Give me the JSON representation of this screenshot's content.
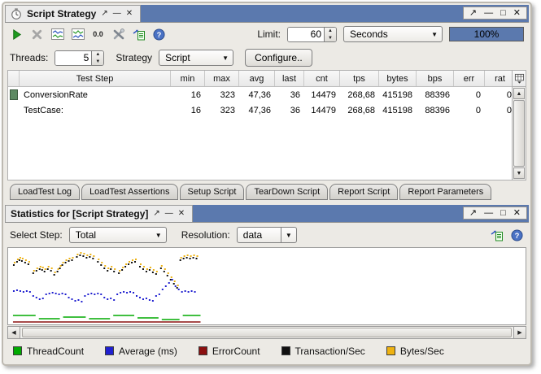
{
  "icons": {
    "float": "↗",
    "minimize": "—",
    "maximize": "□",
    "close": "✕",
    "spin_up": "▲",
    "spin_down": "▼",
    "dropdown": "▼",
    "scroll_up": "▲",
    "scroll_down": "▼",
    "scroll_left": "◀",
    "scroll_right": "▶",
    "help": "?"
  },
  "colors": {
    "titlebar_blue": "#5b79ae",
    "panel_bg": "#eceae5",
    "progress_fill": "#5b79ae",
    "row_icon_green": "#5d8a62"
  },
  "top_panel": {
    "title": "Script Strategy",
    "toolbar": {
      "reset_label": "0.0",
      "limit_label": "Limit:",
      "limit_value": "60",
      "limit_unit": "Seconds",
      "progress": "100%"
    },
    "settings": {
      "threads_label": "Threads:",
      "threads_value": "5",
      "strategy_label": "Strategy",
      "strategy_value": "Script",
      "configure_label": "Configure.."
    },
    "table": {
      "columns": [
        "Test Step",
        "min",
        "max",
        "avg",
        "last",
        "cnt",
        "tps",
        "bytes",
        "bps",
        "err",
        "rat"
      ],
      "rows": [
        {
          "name": "ConversionRate",
          "has_icon": true,
          "values": [
            "16",
            "323",
            "47,36",
            "36",
            "14479",
            "268,68",
            "415198",
            "88396",
            "0",
            "0"
          ]
        },
        {
          "name": "TestCase:",
          "has_icon": false,
          "values": [
            "16",
            "323",
            "47,36",
            "36",
            "14479",
            "268,68",
            "415198",
            "88396",
            "0",
            "0"
          ]
        }
      ]
    },
    "tabs": [
      "LoadTest Log",
      "LoadTest Assertions",
      "Setup Script",
      "TearDown Script",
      "Report Script",
      "Report Parameters"
    ]
  },
  "bottom_panel": {
    "title": "Statistics for [Script Strategy]",
    "select_step_label": "Select Step:",
    "select_step_value": "Total",
    "resolution_label": "Resolution:",
    "resolution_value": "data",
    "legend": [
      {
        "label": "ThreadCount",
        "color": "#00aa00"
      },
      {
        "label": "Average (ms)",
        "color": "#2020d0"
      },
      {
        "label": "ErrorCount",
        "color": "#8b1010"
      },
      {
        "label": "Transaction/Sec",
        "color": "#101010"
      },
      {
        "label": "Bytes/Sec",
        "color": "#eeb211"
      }
    ]
  },
  "chart_data": {
    "type": "scatter",
    "title": "",
    "xlabel": "",
    "ylabel": "",
    "axes_visible": false,
    "legend_position": "bottom",
    "x_range": [
      0,
      640
    ],
    "y_range": [
      0,
      94
    ],
    "y_inverted": true,
    "series": [
      {
        "name": "ErrorCount",
        "color": "#8b1010",
        "style": "line",
        "points": [
          [
            6,
            91
          ],
          [
            238,
            91
          ]
        ]
      },
      {
        "name": "ThreadCount",
        "color": "#00aa00",
        "style": "segments",
        "segments": [
          [
            [
              6,
              83
            ],
            [
              34,
              83
            ]
          ],
          [
            [
              38,
              87
            ],
            [
              64,
              87
            ]
          ],
          [
            [
              68,
              85
            ],
            [
              96,
              85
            ]
          ],
          [
            [
              100,
              87
            ],
            [
              126,
              87
            ]
          ],
          [
            [
              130,
              83
            ],
            [
              156,
              83
            ]
          ],
          [
            [
              160,
              86
            ],
            [
              186,
              86
            ]
          ],
          [
            [
              190,
              88
            ],
            [
              212,
              88
            ]
          ],
          [
            [
              216,
              83
            ],
            [
              238,
              83
            ]
          ]
        ]
      },
      {
        "name": "Average (ms)",
        "color": "#2020d0",
        "style": "dots",
        "points": [
          [
            6,
            52
          ],
          [
            10,
            51
          ],
          [
            14,
            52
          ],
          [
            18,
            53
          ],
          [
            22,
            52
          ],
          [
            26,
            53
          ],
          [
            30,
            58
          ],
          [
            34,
            60
          ],
          [
            38,
            62
          ],
          [
            42,
            61
          ],
          [
            46,
            56
          ],
          [
            50,
            55
          ],
          [
            54,
            54
          ],
          [
            58,
            55
          ],
          [
            62,
            56
          ],
          [
            66,
            55
          ],
          [
            70,
            56
          ],
          [
            74,
            60
          ],
          [
            78,
            62
          ],
          [
            82,
            64
          ],
          [
            86,
            63
          ],
          [
            90,
            65
          ],
          [
            94,
            58
          ],
          [
            98,
            56
          ],
          [
            102,
            55
          ],
          [
            106,
            56
          ],
          [
            110,
            55
          ],
          [
            114,
            56
          ],
          [
            118,
            60
          ],
          [
            122,
            62
          ],
          [
            126,
            61
          ],
          [
            130,
            63
          ],
          [
            134,
            56
          ],
          [
            138,
            54
          ],
          [
            142,
            53
          ],
          [
            146,
            54
          ],
          [
            150,
            53
          ],
          [
            154,
            54
          ],
          [
            158,
            58
          ],
          [
            162,
            60
          ],
          [
            166,
            62
          ],
          [
            170,
            61
          ],
          [
            174,
            63
          ],
          [
            178,
            64
          ],
          [
            182,
            58
          ],
          [
            186,
            56
          ],
          [
            190,
            50
          ],
          [
            194,
            46
          ],
          [
            198,
            42
          ],
          [
            202,
            38
          ],
          [
            206,
            46
          ],
          [
            210,
            50
          ],
          [
            214,
            53
          ],
          [
            218,
            52
          ],
          [
            222,
            53
          ],
          [
            226,
            52
          ],
          [
            230,
            53
          ]
        ]
      },
      {
        "name": "Transaction/Sec",
        "color": "#101010",
        "style": "dots",
        "points": [
          [
            6,
            20
          ],
          [
            10,
            16
          ],
          [
            13,
            14
          ],
          [
            16,
            15
          ],
          [
            20,
            17
          ],
          [
            24,
            19
          ],
          [
            30,
            30
          ],
          [
            34,
            27
          ],
          [
            38,
            25
          ],
          [
            41,
            26
          ],
          [
            44,
            28
          ],
          [
            48,
            25
          ],
          [
            52,
            27
          ],
          [
            56,
            32
          ],
          [
            60,
            28
          ],
          [
            63,
            24
          ],
          [
            66,
            20
          ],
          [
            70,
            17
          ],
          [
            74,
            15
          ],
          [
            78,
            14
          ],
          [
            84,
            10
          ],
          [
            88,
            8
          ],
          [
            92,
            9
          ],
          [
            96,
            11
          ],
          [
            100,
            10
          ],
          [
            104,
            12
          ],
          [
            110,
            16
          ],
          [
            114,
            20
          ],
          [
            118,
            24
          ],
          [
            122,
            27
          ],
          [
            126,
            25
          ],
          [
            130,
            28
          ],
          [
            136,
            30
          ],
          [
            140,
            26
          ],
          [
            144,
            22
          ],
          [
            148,
            19
          ],
          [
            152,
            17
          ],
          [
            156,
            16
          ],
          [
            162,
            22
          ],
          [
            166,
            25
          ],
          [
            170,
            28
          ],
          [
            174,
            26
          ],
          [
            178,
            29
          ],
          [
            182,
            31
          ],
          [
            188,
            24
          ],
          [
            192,
            28
          ],
          [
            196,
            33
          ],
          [
            200,
            38
          ],
          [
            204,
            43
          ],
          [
            208,
            48
          ],
          [
            212,
            14
          ],
          [
            216,
            12
          ],
          [
            220,
            11
          ],
          [
            224,
            12
          ],
          [
            228,
            11
          ],
          [
            232,
            12
          ]
        ]
      },
      {
        "name": "Bytes/Sec",
        "color": "#eeb211",
        "style": "dots",
        "points": [
          [
            7,
            17
          ],
          [
            11,
            13
          ],
          [
            14,
            11
          ],
          [
            17,
            12
          ],
          [
            21,
            14
          ],
          [
            25,
            16
          ],
          [
            31,
            27
          ],
          [
            35,
            24
          ],
          [
            39,
            22
          ],
          [
            42,
            23
          ],
          [
            45,
            25
          ],
          [
            49,
            22
          ],
          [
            53,
            24
          ],
          [
            57,
            29
          ],
          [
            61,
            25
          ],
          [
            64,
            21
          ],
          [
            67,
            17
          ],
          [
            71,
            14
          ],
          [
            75,
            12
          ],
          [
            79,
            11
          ],
          [
            85,
            7
          ],
          [
            89,
            5
          ],
          [
            93,
            6
          ],
          [
            97,
            8
          ],
          [
            101,
            7
          ],
          [
            105,
            9
          ],
          [
            111,
            13
          ],
          [
            115,
            17
          ],
          [
            119,
            21
          ],
          [
            123,
            24
          ],
          [
            127,
            22
          ],
          [
            131,
            25
          ],
          [
            137,
            27
          ],
          [
            141,
            23
          ],
          [
            145,
            19
          ],
          [
            149,
            16
          ],
          [
            153,
            14
          ],
          [
            157,
            13
          ],
          [
            163,
            19
          ],
          [
            167,
            22
          ],
          [
            171,
            25
          ],
          [
            175,
            23
          ],
          [
            179,
            26
          ],
          [
            183,
            28
          ],
          [
            189,
            21
          ],
          [
            193,
            25
          ],
          [
            197,
            30
          ],
          [
            201,
            35
          ],
          [
            205,
            40
          ],
          [
            209,
            45
          ],
          [
            213,
            11
          ],
          [
            217,
            9
          ],
          [
            221,
            8
          ],
          [
            225,
            9
          ],
          [
            229,
            8
          ],
          [
            233,
            9
          ]
        ]
      }
    ]
  }
}
